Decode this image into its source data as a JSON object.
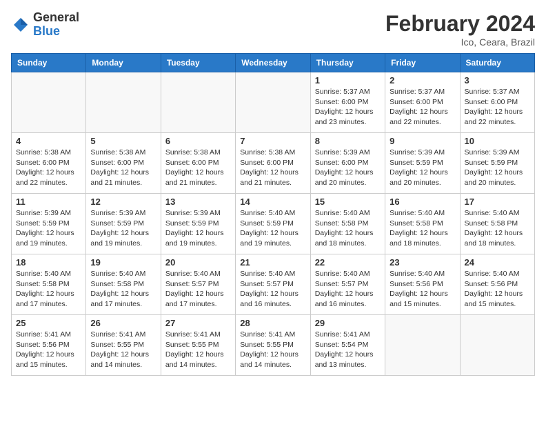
{
  "header": {
    "logo_general": "General",
    "logo_blue": "Blue",
    "month_title": "February 2024",
    "location": "Ico, Ceara, Brazil"
  },
  "days_of_week": [
    "Sunday",
    "Monday",
    "Tuesday",
    "Wednesday",
    "Thursday",
    "Friday",
    "Saturday"
  ],
  "weeks": [
    [
      {
        "day": "",
        "info": ""
      },
      {
        "day": "",
        "info": ""
      },
      {
        "day": "",
        "info": ""
      },
      {
        "day": "",
        "info": ""
      },
      {
        "day": "1",
        "info": "Sunrise: 5:37 AM\nSunset: 6:00 PM\nDaylight: 12 hours\nand 23 minutes."
      },
      {
        "day": "2",
        "info": "Sunrise: 5:37 AM\nSunset: 6:00 PM\nDaylight: 12 hours\nand 22 minutes."
      },
      {
        "day": "3",
        "info": "Sunrise: 5:37 AM\nSunset: 6:00 PM\nDaylight: 12 hours\nand 22 minutes."
      }
    ],
    [
      {
        "day": "4",
        "info": "Sunrise: 5:38 AM\nSunset: 6:00 PM\nDaylight: 12 hours\nand 22 minutes."
      },
      {
        "day": "5",
        "info": "Sunrise: 5:38 AM\nSunset: 6:00 PM\nDaylight: 12 hours\nand 21 minutes."
      },
      {
        "day": "6",
        "info": "Sunrise: 5:38 AM\nSunset: 6:00 PM\nDaylight: 12 hours\nand 21 minutes."
      },
      {
        "day": "7",
        "info": "Sunrise: 5:38 AM\nSunset: 6:00 PM\nDaylight: 12 hours\nand 21 minutes."
      },
      {
        "day": "8",
        "info": "Sunrise: 5:39 AM\nSunset: 6:00 PM\nDaylight: 12 hours\nand 20 minutes."
      },
      {
        "day": "9",
        "info": "Sunrise: 5:39 AM\nSunset: 5:59 PM\nDaylight: 12 hours\nand 20 minutes."
      },
      {
        "day": "10",
        "info": "Sunrise: 5:39 AM\nSunset: 5:59 PM\nDaylight: 12 hours\nand 20 minutes."
      }
    ],
    [
      {
        "day": "11",
        "info": "Sunrise: 5:39 AM\nSunset: 5:59 PM\nDaylight: 12 hours\nand 19 minutes."
      },
      {
        "day": "12",
        "info": "Sunrise: 5:39 AM\nSunset: 5:59 PM\nDaylight: 12 hours\nand 19 minutes."
      },
      {
        "day": "13",
        "info": "Sunrise: 5:39 AM\nSunset: 5:59 PM\nDaylight: 12 hours\nand 19 minutes."
      },
      {
        "day": "14",
        "info": "Sunrise: 5:40 AM\nSunset: 5:59 PM\nDaylight: 12 hours\nand 19 minutes."
      },
      {
        "day": "15",
        "info": "Sunrise: 5:40 AM\nSunset: 5:58 PM\nDaylight: 12 hours\nand 18 minutes."
      },
      {
        "day": "16",
        "info": "Sunrise: 5:40 AM\nSunset: 5:58 PM\nDaylight: 12 hours\nand 18 minutes."
      },
      {
        "day": "17",
        "info": "Sunrise: 5:40 AM\nSunset: 5:58 PM\nDaylight: 12 hours\nand 18 minutes."
      }
    ],
    [
      {
        "day": "18",
        "info": "Sunrise: 5:40 AM\nSunset: 5:58 PM\nDaylight: 12 hours\nand 17 minutes."
      },
      {
        "day": "19",
        "info": "Sunrise: 5:40 AM\nSunset: 5:58 PM\nDaylight: 12 hours\nand 17 minutes."
      },
      {
        "day": "20",
        "info": "Sunrise: 5:40 AM\nSunset: 5:57 PM\nDaylight: 12 hours\nand 17 minutes."
      },
      {
        "day": "21",
        "info": "Sunrise: 5:40 AM\nSunset: 5:57 PM\nDaylight: 12 hours\nand 16 minutes."
      },
      {
        "day": "22",
        "info": "Sunrise: 5:40 AM\nSunset: 5:57 PM\nDaylight: 12 hours\nand 16 minutes."
      },
      {
        "day": "23",
        "info": "Sunrise: 5:40 AM\nSunset: 5:56 PM\nDaylight: 12 hours\nand 15 minutes."
      },
      {
        "day": "24",
        "info": "Sunrise: 5:40 AM\nSunset: 5:56 PM\nDaylight: 12 hours\nand 15 minutes."
      }
    ],
    [
      {
        "day": "25",
        "info": "Sunrise: 5:41 AM\nSunset: 5:56 PM\nDaylight: 12 hours\nand 15 minutes."
      },
      {
        "day": "26",
        "info": "Sunrise: 5:41 AM\nSunset: 5:55 PM\nDaylight: 12 hours\nand 14 minutes."
      },
      {
        "day": "27",
        "info": "Sunrise: 5:41 AM\nSunset: 5:55 PM\nDaylight: 12 hours\nand 14 minutes."
      },
      {
        "day": "28",
        "info": "Sunrise: 5:41 AM\nSunset: 5:55 PM\nDaylight: 12 hours\nand 14 minutes."
      },
      {
        "day": "29",
        "info": "Sunrise: 5:41 AM\nSunset: 5:54 PM\nDaylight: 12 hours\nand 13 minutes."
      },
      {
        "day": "",
        "info": ""
      },
      {
        "day": "",
        "info": ""
      }
    ]
  ]
}
